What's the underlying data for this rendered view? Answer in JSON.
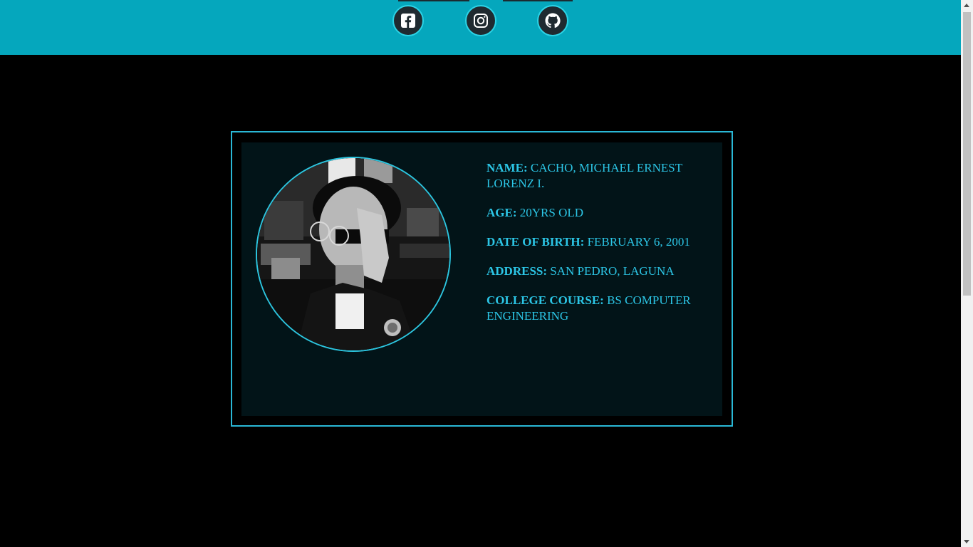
{
  "header": {
    "social_links": [
      {
        "icon": "facebook-icon",
        "label": "Facebook"
      },
      {
        "icon": "instagram-icon",
        "label": "Instagram"
      },
      {
        "icon": "github-icon",
        "label": "GitHub"
      }
    ]
  },
  "profile": {
    "photo_alt": "Profile photo",
    "fields": [
      {
        "key": "NAME:",
        "value": " CACHO, MICHAEL ERNEST LORENZ I."
      },
      {
        "key": "AGE:",
        "value": " 20YRS OLD"
      },
      {
        "key": "DATE OF BIRTH:",
        "value": " FEBRUARY 6, 2001"
      },
      {
        "key": "ADDRESS:",
        "value": " SAN PEDRO, LAGUNA"
      },
      {
        "key": "COLLEGE COURSE:",
        "value": " BS COMPUTER ENGINEERING"
      }
    ]
  },
  "colors": {
    "header_bg": "#05a7bd",
    "accent": "#2cc6e6",
    "card_bg": "#021418",
    "page_bg": "#000000"
  }
}
